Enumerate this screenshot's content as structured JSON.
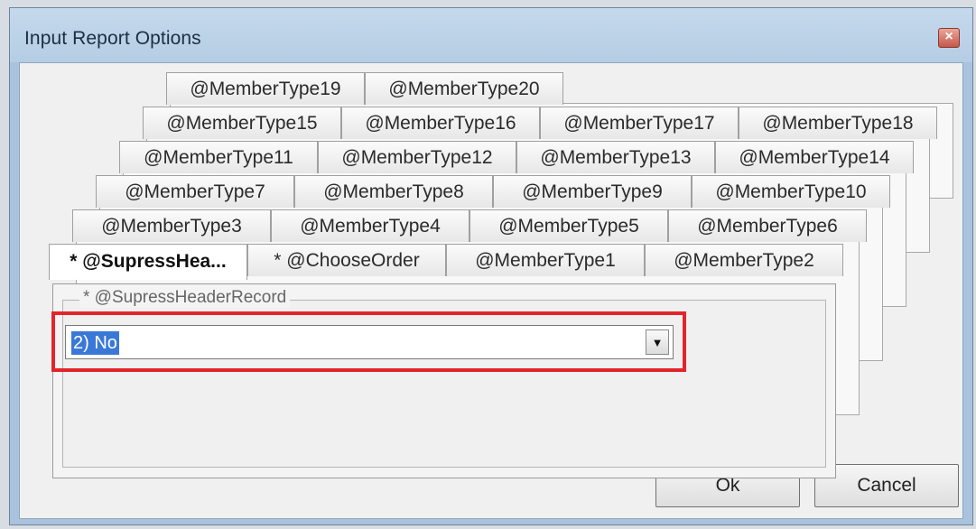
{
  "dialog": {
    "title": "Input Report Options",
    "close_label": "×"
  },
  "tab_rows": [
    [
      "@MemberType19",
      "@MemberType20"
    ],
    [
      "@MemberType15",
      "@MemberType16",
      "@MemberType17",
      "@MemberType18"
    ],
    [
      "@MemberType11",
      "@MemberType12",
      "@MemberType13",
      "@MemberType14"
    ],
    [
      "@MemberType7",
      "@MemberType8",
      "@MemberType9",
      "@MemberType10"
    ],
    [
      "@MemberType3",
      "@MemberType4",
      "@MemberType5",
      "@MemberType6"
    ],
    [
      "* @SupressHea...",
      "* @ChooseOrder",
      "@MemberType1",
      "@MemberType2"
    ]
  ],
  "active_tab": "* @SupressHea...",
  "group": {
    "label": "* @SupressHeaderRecord"
  },
  "combo": {
    "selected_value": "2) No",
    "arrow_icon": "▼"
  },
  "buttons": {
    "ok": "Ok",
    "cancel": "Cancel"
  }
}
